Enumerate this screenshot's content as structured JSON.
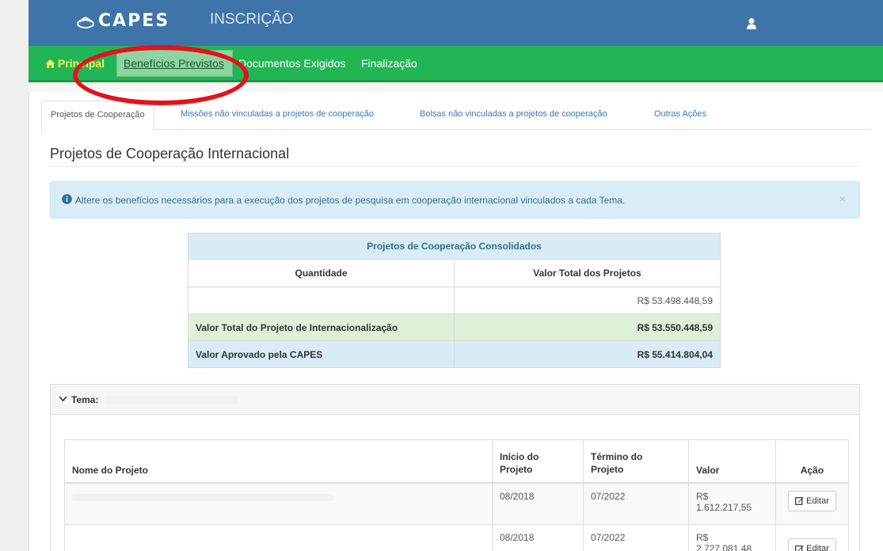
{
  "header": {
    "logo_text": "CAPES",
    "app_title": "INSCRIÇÃO",
    "user_icon": "user-icon",
    "caret_glyph": "▾"
  },
  "nav": {
    "home_label": "Principal",
    "items": [
      "Benefícios Previstos",
      "Documentos Exigidos",
      "Finalização"
    ],
    "active_index": 0
  },
  "tabs": [
    "Projetos de Cooperação",
    "Missões não vinculadas a projetos de cooperação",
    "Bolsas não vinculadas a projetos de cooperação",
    "Outras Ações"
  ],
  "section": {
    "title": "Projetos de Cooperação Internacional"
  },
  "alert": {
    "text": "Altere os benefícios necessários para a execução dos projetos de pesquisa em cooperação internacional vinculados a cada Tema.",
    "close_glyph": "×"
  },
  "consolidated": {
    "title": "Projetos de Cooperação Consolidados",
    "col_quantidade": "Quantidade",
    "col_valor": "Valor Total dos Projetos",
    "quantidade_value": "",
    "valor_value": "R$ 53.498.448,59",
    "row_intl_label": "Valor Total do Projeto de Internacionalização",
    "row_intl_value": "R$ 53.550.448,59",
    "row_capes_label": "Valor Aprovado pela CAPES",
    "row_capes_value": "R$ 55.414.804,04"
  },
  "tema": {
    "label": "Tema:",
    "columns": {
      "nome": "Nome do Projeto",
      "inicio": "Início do Projeto",
      "termino": "Término do Projeto",
      "valor": "Valor",
      "acao": "Ação"
    },
    "rows": [
      {
        "inicio": "08/2018",
        "termino": "07/2022",
        "valor_prefix": "R$",
        "valor_amount": "1.612.217,55",
        "action": "Editar"
      },
      {
        "inicio": "08/2018",
        "termino": "07/2022",
        "valor_prefix": "R$",
        "valor_amount": "2.727.081,48",
        "action": "Editar"
      }
    ]
  },
  "colors": {
    "header_blue": "#3e74a8",
    "nav_green": "#22b555",
    "highlight_red": "#e4121b",
    "alert_bg": "#d9edf7",
    "success_bg": "#dff0d8"
  }
}
